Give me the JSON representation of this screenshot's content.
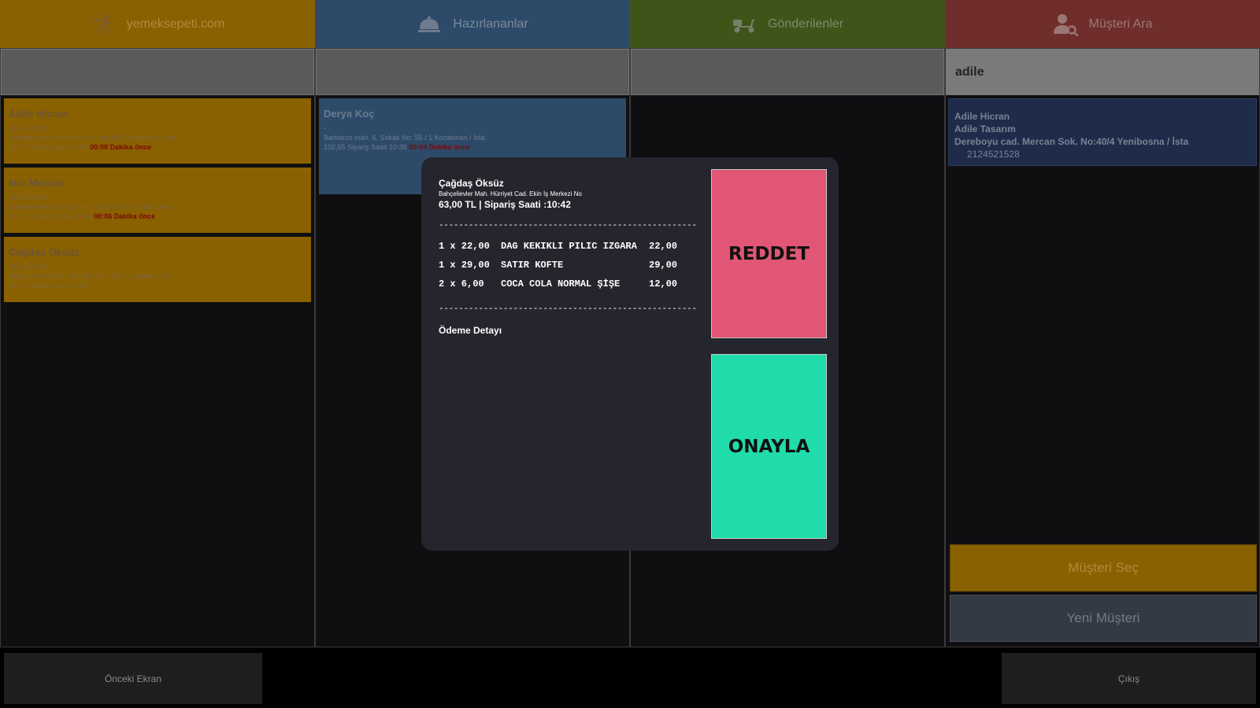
{
  "tabs": [
    {
      "label": "yemeksepeti.com",
      "icon": "runner-icon",
      "color": "#8a6100"
    },
    {
      "label": "Hazırlananlar",
      "icon": "cloche-icon",
      "color": "#2d4b69"
    },
    {
      "label": "Gönderilenler",
      "icon": "scooter-icon",
      "color": "#3f5419"
    },
    {
      "label": "Müşteri Ara",
      "icon": "user-search-icon",
      "color": "#6f2e2b"
    }
  ],
  "col1": {
    "orders": [
      {
        "name": "Adile Hicran",
        "phone": "2124521528",
        "address": "Dereboyu cad. Mercan Sok. No:40/4 Yenibosna / İsta",
        "meta": "52,65  Sipariş Saati 10:35",
        "ago": "00:08 Dakika önce"
      },
      {
        "name": "Nur Mervan",
        "phone": "2124521534",
        "address": "Gültepe Mah. Cengiz Topel Cad. No:24 / 2 Bahçeliev",
        "meta": "130,00  Sipariş Saati 10:36",
        "ago": "00:06 Dakika önce"
      },
      {
        "name": "Çağdaş Öksüz",
        "phone": "2124521529",
        "address": "Bahçelievler Mah. Hürriyet Cad. Ekin İş Merkezi No",
        "meta": "63,00  Sipariş Saati 10:42",
        "ago": ""
      }
    ]
  },
  "col2": {
    "orders": [
      {
        "name": "Derya Koç",
        "phone": "-",
        "address": "Barbaros mah. 6. Sokak No: 55 / 1 Kocasinan / İsta",
        "meta": "102,65  Sipariş Saati 10:38",
        "ago": "00:04 Dakika önce"
      }
    ]
  },
  "col4": {
    "search_value": "adile",
    "customer": {
      "name": "Adile Hicran",
      "company": "Adile Tasarım",
      "address": "Dereboyu cad. Mercan Sok. No:40/4 Yenibosna / İsta",
      "phone": "2124521528"
    },
    "select_label": "Müşteri Seç",
    "new_label": "Yeni Müşteri"
  },
  "bottom": {
    "prev_label": "Önceki Ekran",
    "exit_label": "Çıkış"
  },
  "modal": {
    "customer": "Çağdaş Öksüz",
    "address": "Bahçelievler Mah. Hürriyet Cad. Ekin İş Merkezi No",
    "total": "63,00 TL |  Sipariş Saati :10:42",
    "dashes": "------------------------------------------------------------------------",
    "items": [
      {
        "qty": "1 x 22,00",
        "desc": "DAG KEKIKLI PILIC IZGARA",
        "amount": "22,00"
      },
      {
        "qty": "1 x 29,00",
        "desc": "SATIR KOFTE",
        "amount": "29,00"
      },
      {
        "qty": "2 x 6,00",
        "desc": "COCA COLA NORMAL ŞİŞE",
        "amount": "12,00"
      }
    ],
    "payment_label": "Ödeme Detayı",
    "reject_label": "REDDET",
    "approve_label": "ONAYLA",
    "reject_color": "#e05674",
    "approve_color": "#1fdcaa"
  }
}
